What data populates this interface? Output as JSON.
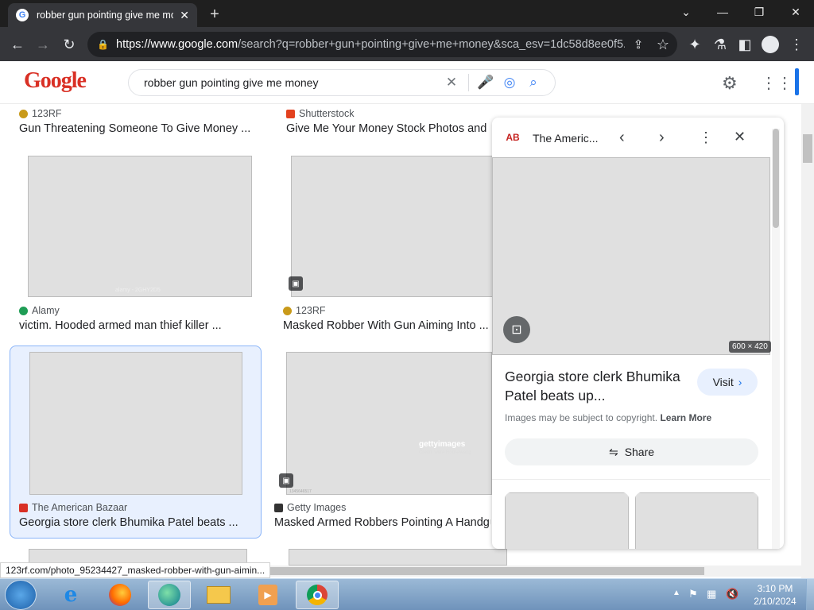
{
  "browser": {
    "tab_title": "robber gun pointing give me mo",
    "tab_favicon_letter": "G",
    "new_tab": "+",
    "url_domain": "https://www.google.com",
    "url_rest": "/search?q=robber+gun+pointing+give+me+money&sca_esv=1dc58d8ee0f5..."
  },
  "google": {
    "logo": "Google",
    "search_query": "robber gun pointing give me money"
  },
  "results": [
    {
      "source": "123RF",
      "title": "Gun Threatening Someone To Give Money ...",
      "fav_color": "#c99a1a"
    },
    {
      "source": "Shutterstock",
      "title": "Give Me Your Money Stock Photos and ...",
      "fav_color": "#e3411e"
    },
    {
      "source": "Alamy",
      "title": "victim. Hooded armed man thief killer ...",
      "fav_color": "#1f9d55"
    },
    {
      "source": "123RF",
      "title": "Masked Robber With Gun Aiming Into ...",
      "fav_color": "#c99a1a"
    },
    {
      "source": "The American Bazaar",
      "title": "Georgia store clerk Bhumika Patel beats ...",
      "fav_color": "#d93025"
    },
    {
      "source": "Getty Images",
      "title": "Masked Armed Robbers Pointing A Handgu",
      "fav_color": "#333333"
    }
  ],
  "image_text": {
    "alamy_id": "alamy - 2GHY2D5",
    "getty_mark": "gettyimages",
    "getty_credit": "Credit: wera Rodsawang",
    "getty_id": "1345646517"
  },
  "panel": {
    "site_name": "The Americ...",
    "site_logo": "AB",
    "image_dims": "600 × 420",
    "title": "Georgia store clerk Bhumika Patel beats up...",
    "visit_label": "Visit",
    "copyright_text": "Images may be subject to copyright.",
    "learn_more": "Learn More",
    "share_label": "Share"
  },
  "status_url": "123rf.com/photo_95234427_masked-robber-with-gun-aimin...",
  "taskbar": {
    "time": "3:10 PM",
    "date": "2/10/2024"
  }
}
